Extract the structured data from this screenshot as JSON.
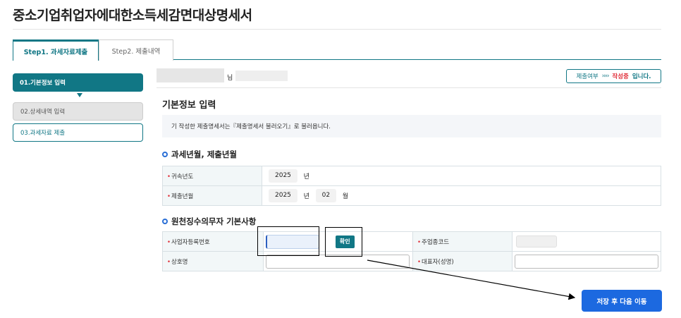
{
  "page": {
    "title": "중소기업취업자에대한소득세감면대상명세서"
  },
  "tabs": [
    {
      "label": "Step1. 과세자료제출",
      "active": true
    },
    {
      "label": "Step2. 제출내역",
      "active": false
    }
  ],
  "steps": [
    {
      "label": "01.기본정보 입력",
      "state": "current"
    },
    {
      "label": "02.상세내역 입력",
      "state": "disabled"
    },
    {
      "label": "03.과세자료 제출",
      "state": "pending"
    }
  ],
  "user": {
    "suffix": "님"
  },
  "status": {
    "prefix": "제출여부",
    "arrows": "››››",
    "state": "작성중",
    "suffix": "입니다."
  },
  "basic": {
    "title": "기본정보 입력",
    "info": "기 작성한 제출명세서는『제출명세서 불러오기』로 불러옵니다."
  },
  "section1": {
    "title": "과세년월, 제출년월",
    "rows": {
      "belong_year_label": "귀속년도",
      "belong_year_value": "2025",
      "submit_month_label": "제출년월",
      "submit_year_value": "2025",
      "submit_month_value": "02",
      "unit_year": "년",
      "unit_month": "월"
    }
  },
  "section2": {
    "title": "원천징수의무자 기본사항",
    "biz_no_label": "사업자등록번호",
    "confirm_label": "확인",
    "industry_code_label": "주업종코드",
    "company_name_label": "상호명",
    "representative_label": "대표자(성명)"
  },
  "footer": {
    "save_label": "저장 후 다음 이동"
  },
  "colors": {
    "accent": "#117785",
    "primary": "#1c69e0",
    "required": "#e0303a"
  }
}
